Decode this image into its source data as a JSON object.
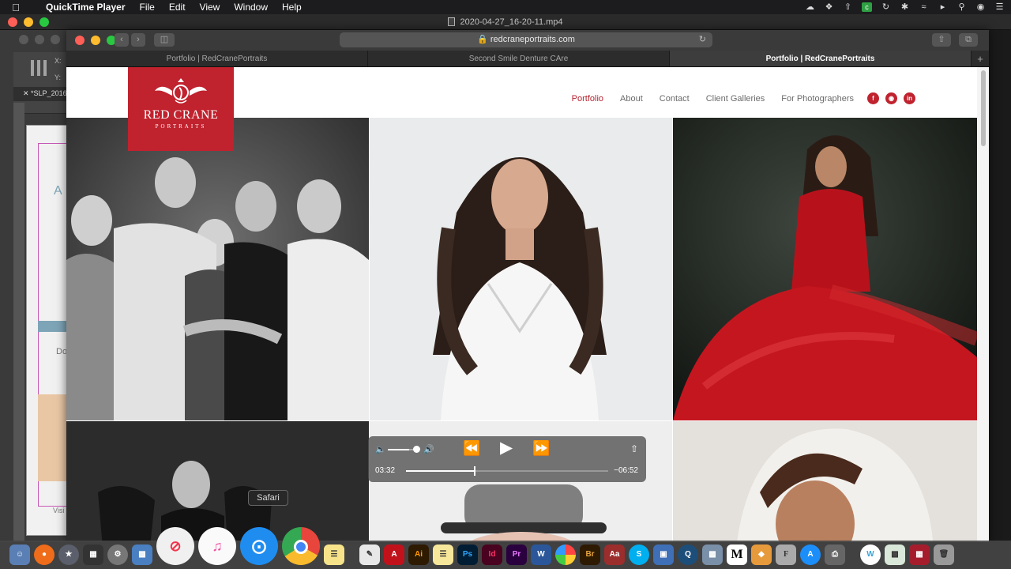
{
  "menubar": {
    "app_name": "QuickTime Player",
    "menus": [
      "File",
      "Edit",
      "View",
      "Window",
      "Help"
    ]
  },
  "quicktime": {
    "document_title": "2020-04-27_16-20-11.mp4"
  },
  "background_app": {
    "x_label": "X:",
    "y_label": "Y:",
    "tab_label": "*SLP_2016",
    "doc_text_a": "A",
    "doc_text_do": "Do",
    "doc_text_visi": "Visi"
  },
  "safari": {
    "url": "redcraneportraits.com",
    "tabs": [
      {
        "label": "Portfolio | RedCranePortraits",
        "active": false
      },
      {
        "label": "Second Smile Denture CAre",
        "active": false
      },
      {
        "label": "Portfolio | RedCranePortraits",
        "active": true
      }
    ]
  },
  "site": {
    "logo_name": "RED CRANE",
    "logo_sub": "PORTRAITS",
    "nav": [
      {
        "label": "Portfolio",
        "active": true
      },
      {
        "label": "About",
        "active": false
      },
      {
        "label": "Contact",
        "active": false
      },
      {
        "label": "Client Galleries",
        "active": false
      },
      {
        "label": "For Photographers",
        "active": false
      }
    ],
    "social": [
      "facebook-icon",
      "instagram-icon",
      "linkedin-icon"
    ],
    "brand_color": "#c0222e"
  },
  "player": {
    "current_time": "03:32",
    "remaining_time": "−06:52",
    "progress": 0.34,
    "volume": 0.72
  },
  "tooltip": "Safari",
  "dock": {
    "apps": [
      "Finder",
      "Firefox",
      "Launchpad",
      "Mission Control",
      "System Preferences",
      "Preview",
      "News",
      "iTunes",
      "Safari",
      "Chrome",
      "Notes",
      "TextEdit",
      "Acrobat",
      "Illustrator",
      "Stickies",
      "Photoshop",
      "InDesign",
      "Premiere",
      "Word",
      "Photos",
      "Bridge",
      "Dictionary",
      "Skype",
      "Keynote",
      "QuickTime",
      "Image Capture",
      "Mindnode",
      "Sketch",
      "Font Book",
      "App Store",
      "Printer",
      "Word Web",
      "Preview 2",
      "Photo Booth",
      "Trash"
    ]
  }
}
